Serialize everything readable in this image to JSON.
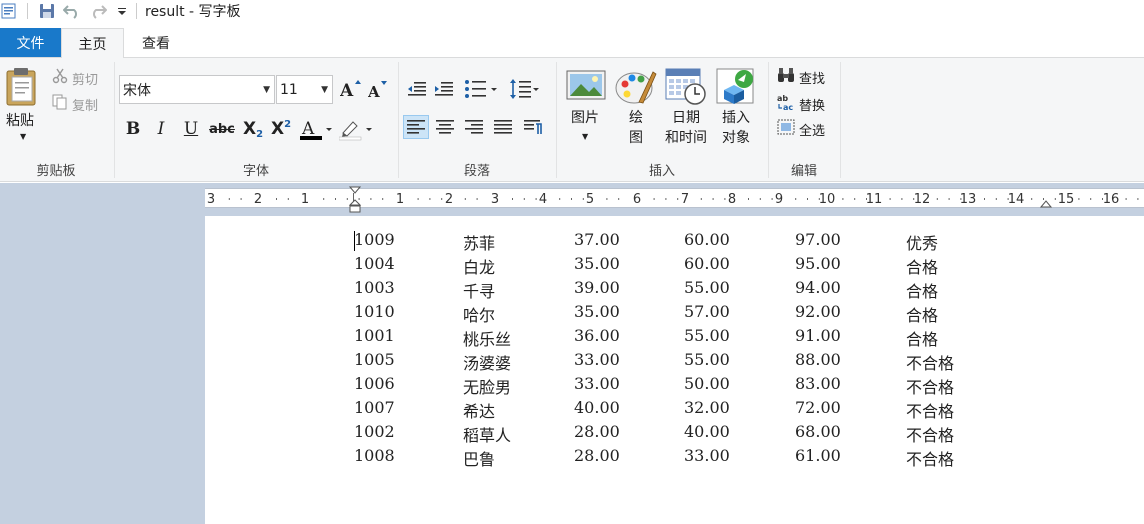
{
  "window": {
    "title": "result - 写字板"
  },
  "tabs": {
    "file": "文件",
    "home": "主页",
    "view": "查看"
  },
  "clipboard": {
    "paste": "粘贴",
    "cut": "剪切",
    "copy": "复制",
    "group_label": "剪贴板"
  },
  "font": {
    "family": "宋体",
    "size": "11",
    "group_label": "字体"
  },
  "paragraph": {
    "group_label": "段落"
  },
  "insert": {
    "picture": "图片",
    "paint_line1": "绘",
    "paint_line2": "图",
    "datetime_line1": "日期",
    "datetime_line2": "和时间",
    "object_line1": "插入",
    "object_line2": "对象",
    "group_label": "插入"
  },
  "editing": {
    "find": "查找",
    "replace": "替换",
    "select_all": "全选",
    "group_label": "编辑"
  },
  "ruler": {
    "labels": [
      "3",
      "2",
      "1",
      "1",
      "2",
      "3",
      "4",
      "5",
      "6",
      "7",
      "8",
      "9",
      "10",
      "11",
      "12",
      "13",
      "14",
      "15",
      "16"
    ]
  },
  "document": {
    "rows": [
      [
        "1009",
        "苏菲",
        "37.00",
        "60.00",
        "97.00",
        "优秀"
      ],
      [
        "1004",
        "白龙",
        "35.00",
        "60.00",
        "95.00",
        "合格"
      ],
      [
        "1003",
        "千寻",
        "39.00",
        "55.00",
        "94.00",
        "合格"
      ],
      [
        "1010",
        "哈尔",
        "35.00",
        "57.00",
        "92.00",
        "合格"
      ],
      [
        "1001",
        "桃乐丝",
        "36.00",
        "55.00",
        "91.00",
        "合格"
      ],
      [
        "1005",
        "汤婆婆",
        "33.00",
        "55.00",
        "88.00",
        "不合格"
      ],
      [
        "1006",
        "无脸男",
        "33.00",
        "50.00",
        "83.00",
        "不合格"
      ],
      [
        "1007",
        "希达",
        "40.00",
        "32.00",
        "72.00",
        "不合格"
      ],
      [
        "1002",
        "稻草人",
        "28.00",
        "40.00",
        "68.00",
        "不合格"
      ],
      [
        "1008",
        "巴鲁",
        "28.00",
        "33.00",
        "61.00",
        "不合格"
      ]
    ]
  },
  "colors": {
    "file_tab": "#1979ca",
    "ribbon_bg": "#f5f6f7",
    "workspace": "#c4d0e0",
    "active_button": "#cce4f7"
  }
}
